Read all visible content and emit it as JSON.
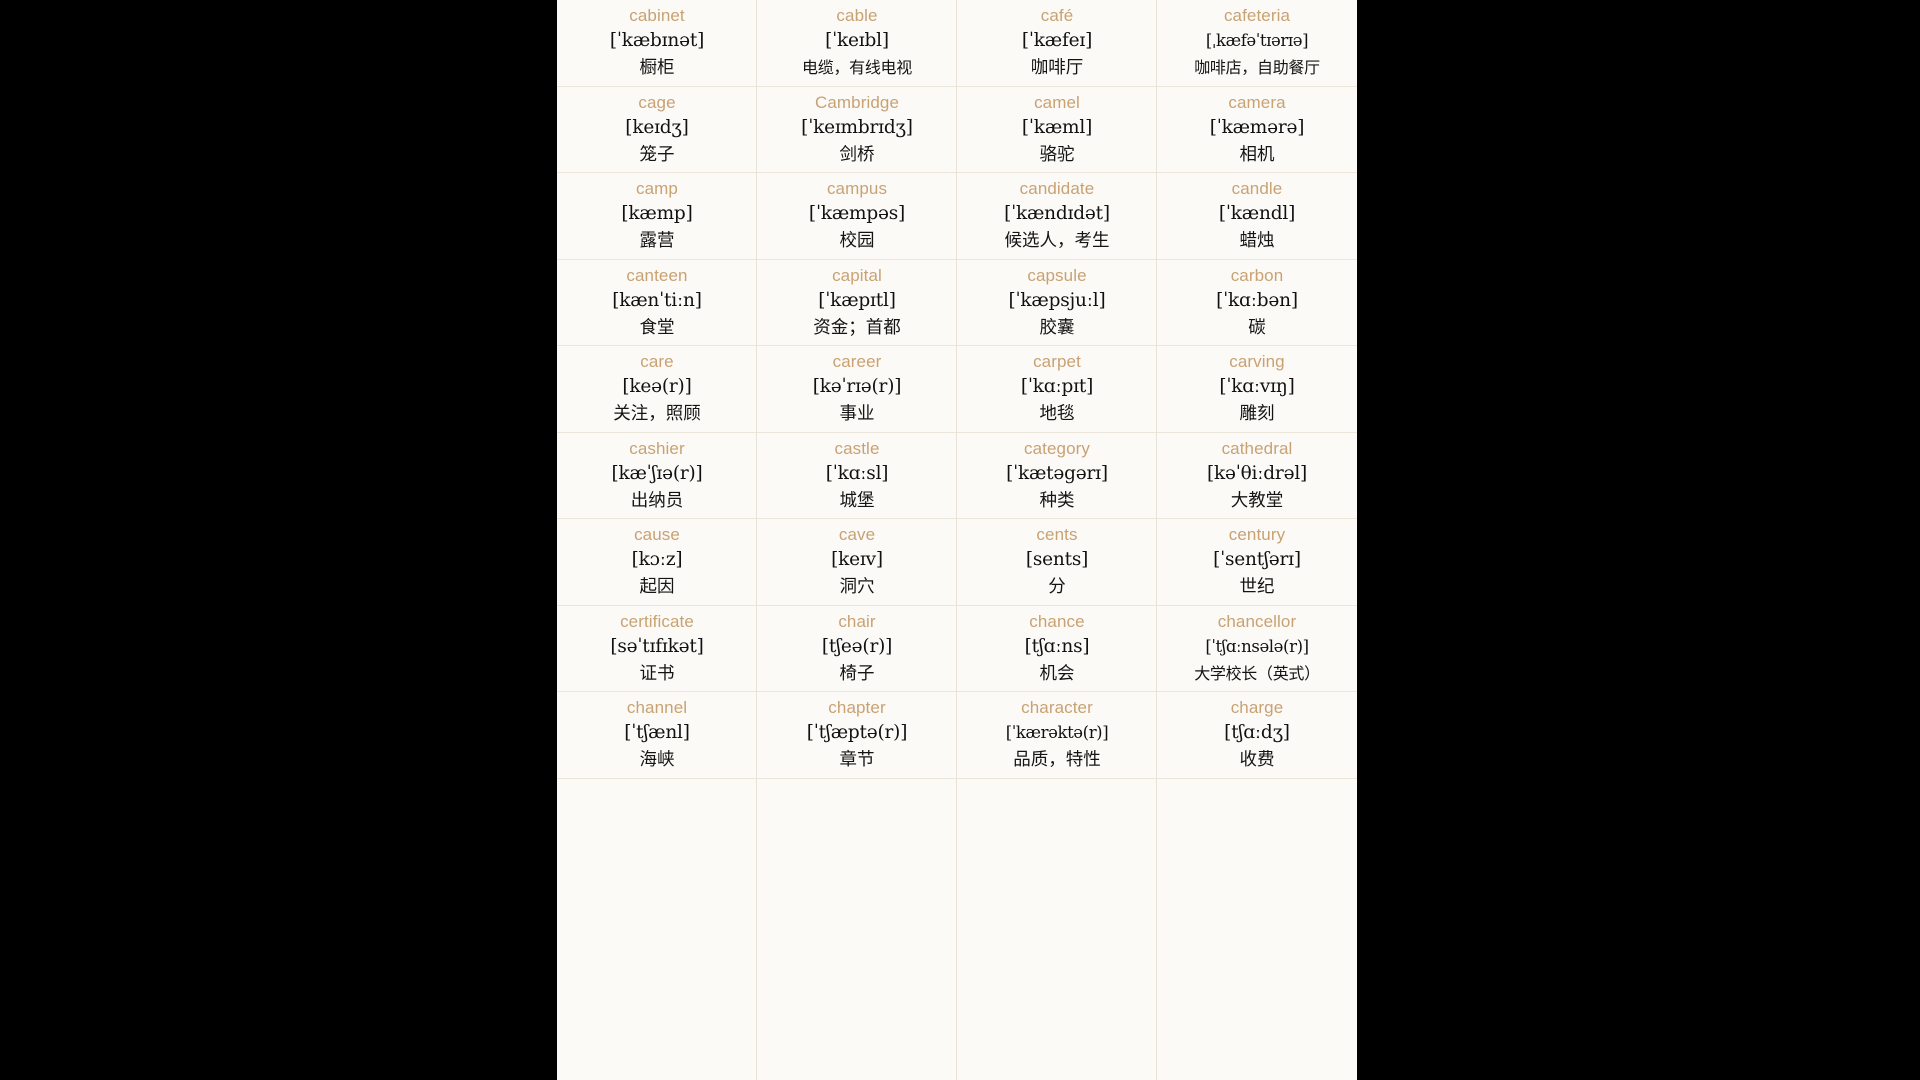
{
  "page": {
    "background_color": "#fbfaf7",
    "letterbox_color": "#000000",
    "word_color": "#c9a273",
    "text_color": "#111111",
    "divider_color": "#ece5da",
    "columns": 4
  },
  "entries": [
    {
      "word": "cabinet",
      "ipa": "[ˈkæbɪnət]",
      "cn": "橱柜"
    },
    {
      "word": "cable",
      "ipa": "[ˈkeɪbl]",
      "cn": "电缆，有线电视"
    },
    {
      "word": "café",
      "ipa": "[ˈkæfeɪ]",
      "cn": "咖啡厅"
    },
    {
      "word": "cafeteria",
      "ipa": "[ˌkæfəˈtɪərɪə]",
      "cn": "咖啡店，自助餐厅"
    },
    {
      "word": "cage",
      "ipa": "[keɪdʒ]",
      "cn": "笼子"
    },
    {
      "word": "Cambridge",
      "ipa": "[ˈkeɪmbrɪdʒ]",
      "cn": "剑桥"
    },
    {
      "word": "camel",
      "ipa": "[ˈkæml]",
      "cn": "骆驼"
    },
    {
      "word": "camera",
      "ipa": "[ˈkæmərə]",
      "cn": "相机"
    },
    {
      "word": "camp",
      "ipa": "[kæmp]",
      "cn": "露营"
    },
    {
      "word": "campus",
      "ipa": "[ˈkæmpəs]",
      "cn": "校园"
    },
    {
      "word": "candidate",
      "ipa": "[ˈkændɪdət]",
      "cn": "候选人，考生"
    },
    {
      "word": "candle",
      "ipa": "[ˈkændl]",
      "cn": "蜡烛"
    },
    {
      "word": "canteen",
      "ipa": "[kænˈtiːn]",
      "cn": "食堂"
    },
    {
      "word": "capital",
      "ipa": "[ˈkæpɪtl]",
      "cn": "资金；首都"
    },
    {
      "word": "capsule",
      "ipa": "[ˈkæpsjuːl]",
      "cn": "胶囊"
    },
    {
      "word": "carbon",
      "ipa": "[ˈkɑːbən]",
      "cn": "碳"
    },
    {
      "word": "care",
      "ipa": "[keə(r)]",
      "cn": "关注，照顾"
    },
    {
      "word": "career",
      "ipa": "[kəˈrɪə(r)]",
      "cn": "事业"
    },
    {
      "word": "carpet",
      "ipa": "[ˈkɑːpɪt]",
      "cn": "地毯"
    },
    {
      "word": "carving",
      "ipa": "[ˈkɑːvɪŋ]",
      "cn": "雕刻"
    },
    {
      "word": "cashier",
      "ipa": "[kæˈʃɪə(r)]",
      "cn": "出纳员"
    },
    {
      "word": "castle",
      "ipa": "[ˈkɑːsl]",
      "cn": "城堡"
    },
    {
      "word": "category",
      "ipa": "[ˈkætəgərɪ]",
      "cn": "种类"
    },
    {
      "word": "cathedral",
      "ipa": "[kəˈθiːdrəl]",
      "cn": "大教堂"
    },
    {
      "word": "cause",
      "ipa": "[kɔːz]",
      "cn": "起因"
    },
    {
      "word": "cave",
      "ipa": "[keɪv]",
      "cn": "洞穴"
    },
    {
      "word": "cents",
      "ipa": "[sents]",
      "cn": "分"
    },
    {
      "word": "century",
      "ipa": "[ˈsentʃərɪ]",
      "cn": "世纪"
    },
    {
      "word": "certificate",
      "ipa": "[səˈtɪfɪkət]",
      "cn": "证书"
    },
    {
      "word": "chair",
      "ipa": "[tʃeə(r)]",
      "cn": "椅子"
    },
    {
      "word": "chance",
      "ipa": "[tʃɑːns]",
      "cn": "机会"
    },
    {
      "word": "chancellor",
      "ipa": "[ˈtʃɑːnsələ(r)]",
      "cn": "大学校长（英式）"
    },
    {
      "word": "channel",
      "ipa": "[ˈtʃænl]",
      "cn": "海峡"
    },
    {
      "word": "chapter",
      "ipa": "[ˈtʃæptə(r)]",
      "cn": "章节"
    },
    {
      "word": "character",
      "ipa": "[ˈkærəktə(r)]",
      "cn": "品质，特性"
    },
    {
      "word": "charge",
      "ipa": "[tʃɑːdʒ]",
      "cn": "收费"
    }
  ]
}
